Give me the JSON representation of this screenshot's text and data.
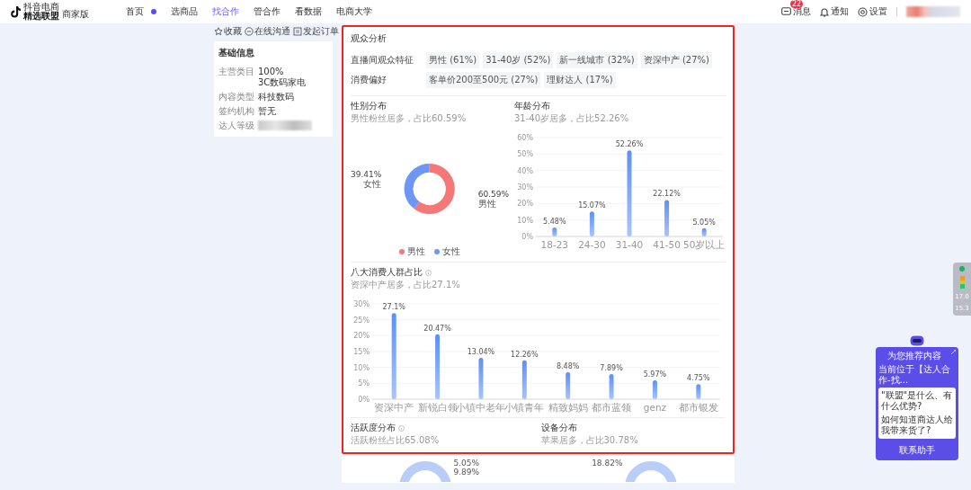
{
  "header": {
    "logo_small": "抖音电商",
    "logo_main": "精选联盟",
    "logo_edition": "商家版",
    "nav": [
      {
        "label": "首页",
        "selected": false,
        "dot": true
      },
      {
        "label": "选商品",
        "selected": false
      },
      {
        "label": "找合作",
        "selected": true
      },
      {
        "label": "管合作",
        "selected": false
      },
      {
        "label": "看数据",
        "selected": false
      },
      {
        "label": "电商大学",
        "selected": false
      }
    ],
    "actions": [
      {
        "kind": "message",
        "label": "消息",
        "badge": "22"
      },
      {
        "kind": "bell",
        "label": "通知"
      },
      {
        "kind": "gear",
        "label": "设置"
      }
    ]
  },
  "sidebar": {
    "actions": [
      {
        "kind": "star",
        "label": "收藏"
      },
      {
        "kind": "chat",
        "label": "在线沟通"
      },
      {
        "kind": "order",
        "label": "发起订单"
      }
    ],
    "info_title": "基础信息",
    "info": [
      {
        "label": "主营类目",
        "values": [
          "100%",
          "3C数码家电"
        ]
      },
      {
        "label": "内容类型",
        "values": [
          "科技数码"
        ]
      },
      {
        "label": "签约机构",
        "values": [
          "暂无"
        ]
      },
      {
        "label": "达人等级",
        "redacted": true
      }
    ]
  },
  "audience": {
    "title": "观众分析",
    "trait_rows": [
      {
        "label": "直播间观众特征",
        "tags": [
          "男性 (61%)",
          "31-40岁 (52%)",
          "新一线城市 (32%)",
          "资深中产 (27%)"
        ]
      },
      {
        "label": "消费偏好",
        "tags": [
          "客单价200至500元 (27%)",
          "理财达人 (17%)"
        ]
      }
    ],
    "gender": {
      "title": "性别分布",
      "subtitle": "男性粉丝居多，占比60.59%",
      "chart_data": {
        "type": "donut",
        "categories": [
          "男性",
          "女性"
        ],
        "values": [
          60.59,
          39.41
        ]
      },
      "slice_labels": [
        {
          "value": "60.59%",
          "label": "男性"
        },
        {
          "value": "39.41%",
          "label": "女性"
        }
      ],
      "legend": [
        {
          "color": "#f47878"
        },
        {
          "color": "#6d97f4"
        }
      ]
    },
    "age": {
      "title": "年龄分布",
      "subtitle": "31-40岁居多，占比52.26%",
      "chart_data": {
        "type": "bar",
        "categories": [
          "18-23",
          "24-30",
          "31-40",
          "41-50",
          "50岁以上"
        ],
        "values": [
          5.48,
          15.07,
          52.26,
          22.12,
          5.05
        ],
        "ylim": [
          0,
          60
        ],
        "yticks": [
          {
            "value": 0,
            "label": "0%"
          },
          {
            "value": 10,
            "label": "10%"
          },
          {
            "value": 20,
            "label": "20%"
          },
          {
            "value": 30,
            "label": "30%"
          },
          {
            "value": 40,
            "label": "40%"
          },
          {
            "value": 50,
            "label": "50%"
          },
          {
            "value": 60,
            "label": "60%"
          }
        ],
        "value_labels": [
          "5.48%",
          "15.07%",
          "52.26%",
          "22.12%",
          "5.05%"
        ],
        "grid": true
      }
    },
    "consumers": {
      "title": "八大消费人群占比",
      "info_icon": true,
      "subtitle": "资深中产居多，占比27.1%",
      "chart_data": {
        "type": "bar",
        "categories": [
          "资深中产",
          "新锐白领",
          "小镇中老年",
          "小镇青年",
          "精致妈妈",
          "都市蓝领",
          "genz",
          "都市银发"
        ],
        "values": [
          27.1,
          20.47,
          13.04,
          12.26,
          8.48,
          7.89,
          5.97,
          4.75
        ],
        "ylim": [
          0,
          30
        ],
        "yticks": [
          {
            "value": 0,
            "label": "0%"
          },
          {
            "value": 5,
            "label": "5%"
          },
          {
            "value": 10,
            "label": "10%"
          },
          {
            "value": 15,
            "label": "15%"
          },
          {
            "value": 20,
            "label": "20%"
          },
          {
            "value": 25,
            "label": "25%"
          },
          {
            "value": 30,
            "label": "30%"
          }
        ],
        "value_labels": [
          "27.1%",
          "20.47%",
          "13.04%",
          "12.26%",
          "8.48%",
          "7.89%",
          "5.97%",
          "4.75%"
        ],
        "grid": true
      }
    },
    "activity": {
      "title": "活跃度分布",
      "info_icon": true,
      "subtitle": "活跃粉丝占比65.08%"
    },
    "device": {
      "title": "设备分布",
      "subtitle": "苹果居多，占比30.78%"
    },
    "peek_labels": [
      "5.05%",
      "9.89%",
      "18.82%"
    ]
  },
  "perf": {
    "readings": [
      "17.0",
      "15.3"
    ]
  },
  "helper": {
    "title": "为您推荐内容",
    "context": "当前位于【达人合作-找...",
    "questions": [
      "\"联盟\"是什么、有什么优势?",
      "如何知道商达人给我带来货了?"
    ],
    "button": "联系助手"
  }
}
